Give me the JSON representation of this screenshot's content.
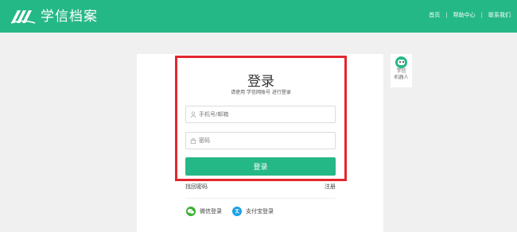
{
  "header": {
    "brand": "学信档案",
    "nav": [
      "首页",
      "帮助中心",
      "联系我们"
    ],
    "separator": "|"
  },
  "login": {
    "title": "登录",
    "subtitle": "请使用 学信网账号 进行登录",
    "username_placeholder": "手机号/邮箱",
    "password_placeholder": "密码",
    "submit_label": "登录",
    "forgot_label": "找回密码",
    "register_label": "注册"
  },
  "third_party": {
    "wechat": "微信登录",
    "alipay": "支付宝登录"
  },
  "robot": {
    "line1": "学信",
    "line2": "机器人"
  },
  "colors": {
    "brand_green": "#25b887",
    "highlight_red": "#e3262d",
    "wechat_green": "#3cb035",
    "alipay_blue": "#1aa0e6"
  },
  "icons": {
    "user": "user-icon",
    "lock": "lock-icon",
    "wechat": "wechat-icon",
    "alipay": "alipay-icon",
    "robot": "robot-icon",
    "logo": "book-logo-icon"
  }
}
